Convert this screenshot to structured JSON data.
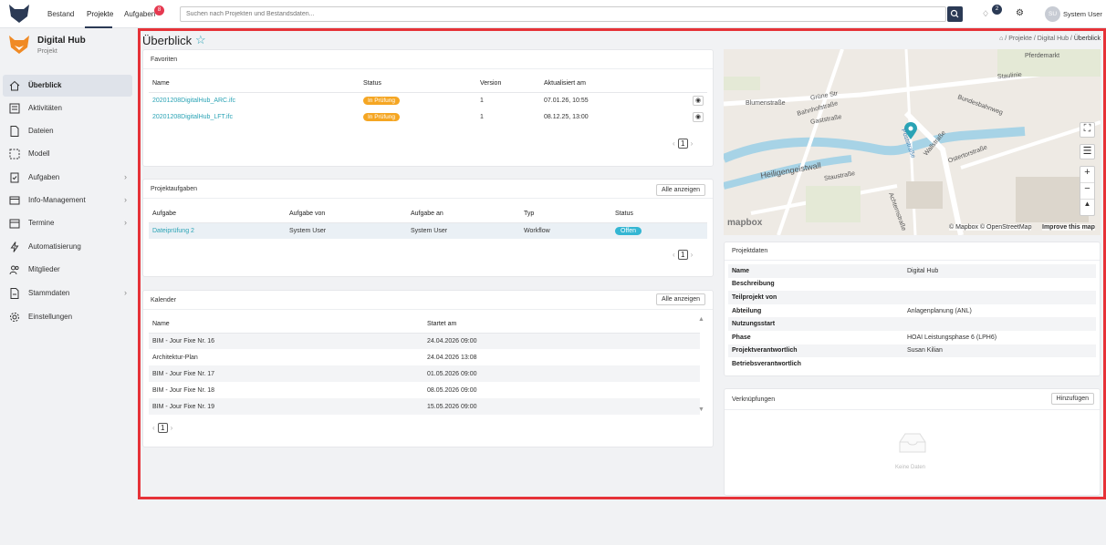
{
  "topbar": {
    "nav": [
      "Bestand",
      "Projekte",
      "Aufgaben"
    ],
    "tasks_badge": "8",
    "search_placeholder": "Suchen nach Projekten und Bestandsdaten...",
    "notif_badge": "2",
    "user_initials": "SU",
    "user_name": "System User"
  },
  "project": {
    "name": "Digital Hub",
    "sub": "Projekt"
  },
  "sidebar": {
    "items": [
      {
        "label": "Überblick",
        "icon": "home-icon"
      },
      {
        "label": "Aktivitäten",
        "icon": "activity-icon"
      },
      {
        "label": "Dateien",
        "icon": "file-icon"
      },
      {
        "label": "Modell",
        "icon": "model-icon"
      },
      {
        "label": "Aufgaben",
        "icon": "tasks-icon"
      },
      {
        "label": "Info-Management",
        "icon": "info-management-icon"
      },
      {
        "label": "Termine",
        "icon": "calendar-icon"
      },
      {
        "label": "Automatisierung",
        "icon": "lightning-icon"
      },
      {
        "label": "Mitglieder",
        "icon": "members-icon"
      },
      {
        "label": "Stammdaten",
        "icon": "master-data-icon"
      },
      {
        "label": "Einstellungen",
        "icon": "gear-icon"
      }
    ]
  },
  "page": {
    "title": "Überblick",
    "breadcrumb": [
      "Projekte",
      "Digital Hub",
      "Überblick"
    ]
  },
  "favorites": {
    "title": "Favoriten",
    "headers": [
      "Name",
      "Status",
      "Version",
      "Aktualisiert am"
    ],
    "rows": [
      {
        "name": "20201208DigitalHub_ARC.ifc",
        "status": "In Prüfung",
        "version": "1",
        "updated": "07.01.26, 10:55"
      },
      {
        "name": "20201208DigitalHub_LFT.ifc",
        "status": "In Prüfung",
        "version": "1",
        "updated": "08.12.25, 13:00"
      }
    ],
    "page": "1"
  },
  "tasks": {
    "title": "Projektaufgaben",
    "show_all": "Alle anzeigen",
    "headers": [
      "Aufgabe",
      "Aufgabe von",
      "Aufgabe an",
      "Typ",
      "Status"
    ],
    "rows": [
      {
        "task": "Dateiprüfung 2",
        "from": "System User",
        "to": "System User",
        "type": "Workflow",
        "status": "Offen"
      }
    ],
    "page": "1"
  },
  "calendar": {
    "title": "Kalender",
    "show_all": "Alle anzeigen",
    "headers": [
      "Name",
      "Startet am"
    ],
    "rows": [
      {
        "name": "BIM - Jour Fixe Nr. 16",
        "start": "24.04.2026 09:00"
      },
      {
        "name": "Architektur-Plan",
        "start": "24.04.2026 13:08"
      },
      {
        "name": "BIM - Jour Fixe Nr. 17",
        "start": "01.05.2026 09:00"
      },
      {
        "name": "BIM - Jour Fixe Nr. 18",
        "start": "08.05.2026 09:00"
      },
      {
        "name": "BIM - Jour Fixe Nr. 19",
        "start": "15.05.2026 09:00"
      }
    ],
    "page": "1"
  },
  "map": {
    "labels": [
      "Pferdemarkt",
      "Heiligengeistwall",
      "Staustraße",
      "Poststraße",
      "Ostertorstraße",
      "Bundesbahnweg",
      "Achternstraße",
      "Wallstraße",
      "Gaststraße",
      "Bahnhofstraße",
      "Blumenstraße",
      "Grüne Str",
      "Staulinie"
    ],
    "brand": "mapbox",
    "attribution": "© Mapbox © OpenStreetMap",
    "improve": "Improve this map"
  },
  "project_data": {
    "title": "Projektdaten",
    "rows": [
      {
        "key": "Name",
        "value": "Digital Hub"
      },
      {
        "key": "Beschreibung",
        "value": ""
      },
      {
        "key": "Teilprojekt von",
        "value": ""
      },
      {
        "key": "Abteilung",
        "value": "Anlagenplanung (ANL)"
      },
      {
        "key": "Nutzungsstart",
        "value": ""
      },
      {
        "key": "Phase",
        "value": "HOAI Leistungsphase 6 (LPH6)"
      },
      {
        "key": "Projektverantwortlich",
        "value": "Susan Kilian"
      },
      {
        "key": "Betriebsverantwortlich",
        "value": ""
      }
    ]
  },
  "links": {
    "title": "Verknüpfungen",
    "add": "Hinzufügen",
    "empty": "Keine Daten"
  },
  "colors": {
    "accent": "#2aa3b5",
    "navy": "#2b3a55",
    "warning": "#f5a623",
    "info": "#34b6d3",
    "badge": "#e63950",
    "frame": "#e63238"
  }
}
